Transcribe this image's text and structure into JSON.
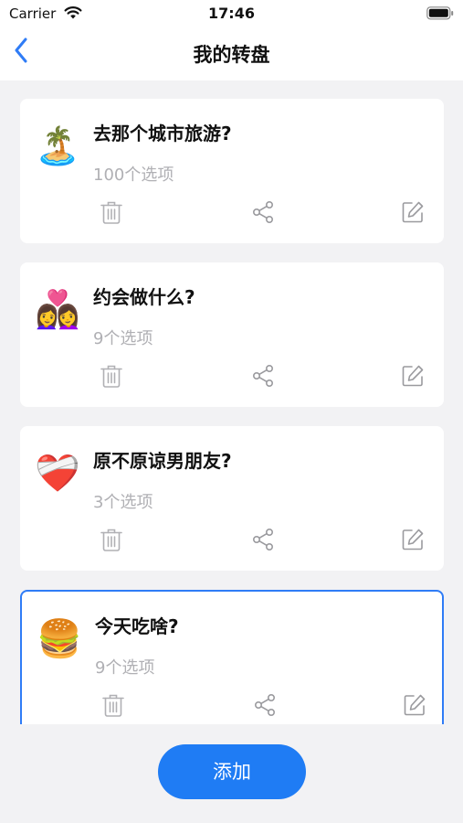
{
  "status_bar": {
    "carrier": "Carrier",
    "time": "17:46"
  },
  "nav": {
    "title": "我的转盘",
    "back_icon": "chevron-left-icon"
  },
  "wheels": [
    {
      "emoji": "🏝️",
      "title": "去那个城市旅游?",
      "count": "100个选项",
      "selected": false
    },
    {
      "emoji": "👩‍❤️‍👩",
      "title": "约会做什么?",
      "count": "9个选项",
      "selected": false
    },
    {
      "emoji": "❤️‍🩹",
      "title": "原不原谅男朋友?",
      "count": "3个选项",
      "selected": false
    },
    {
      "emoji": "🍔",
      "title": "今天吃啥?",
      "count": "9个选项",
      "selected": true
    }
  ],
  "actions": {
    "delete_icon": "trash-icon",
    "share_icon": "share-icon",
    "edit_icon": "edit-icon"
  },
  "add_button": {
    "label": "添加"
  },
  "colors": {
    "accent": "#1f7cf4",
    "selected_border": "#2f7cf6",
    "muted_text": "#b0b0b4",
    "background": "#f2f2f4"
  }
}
